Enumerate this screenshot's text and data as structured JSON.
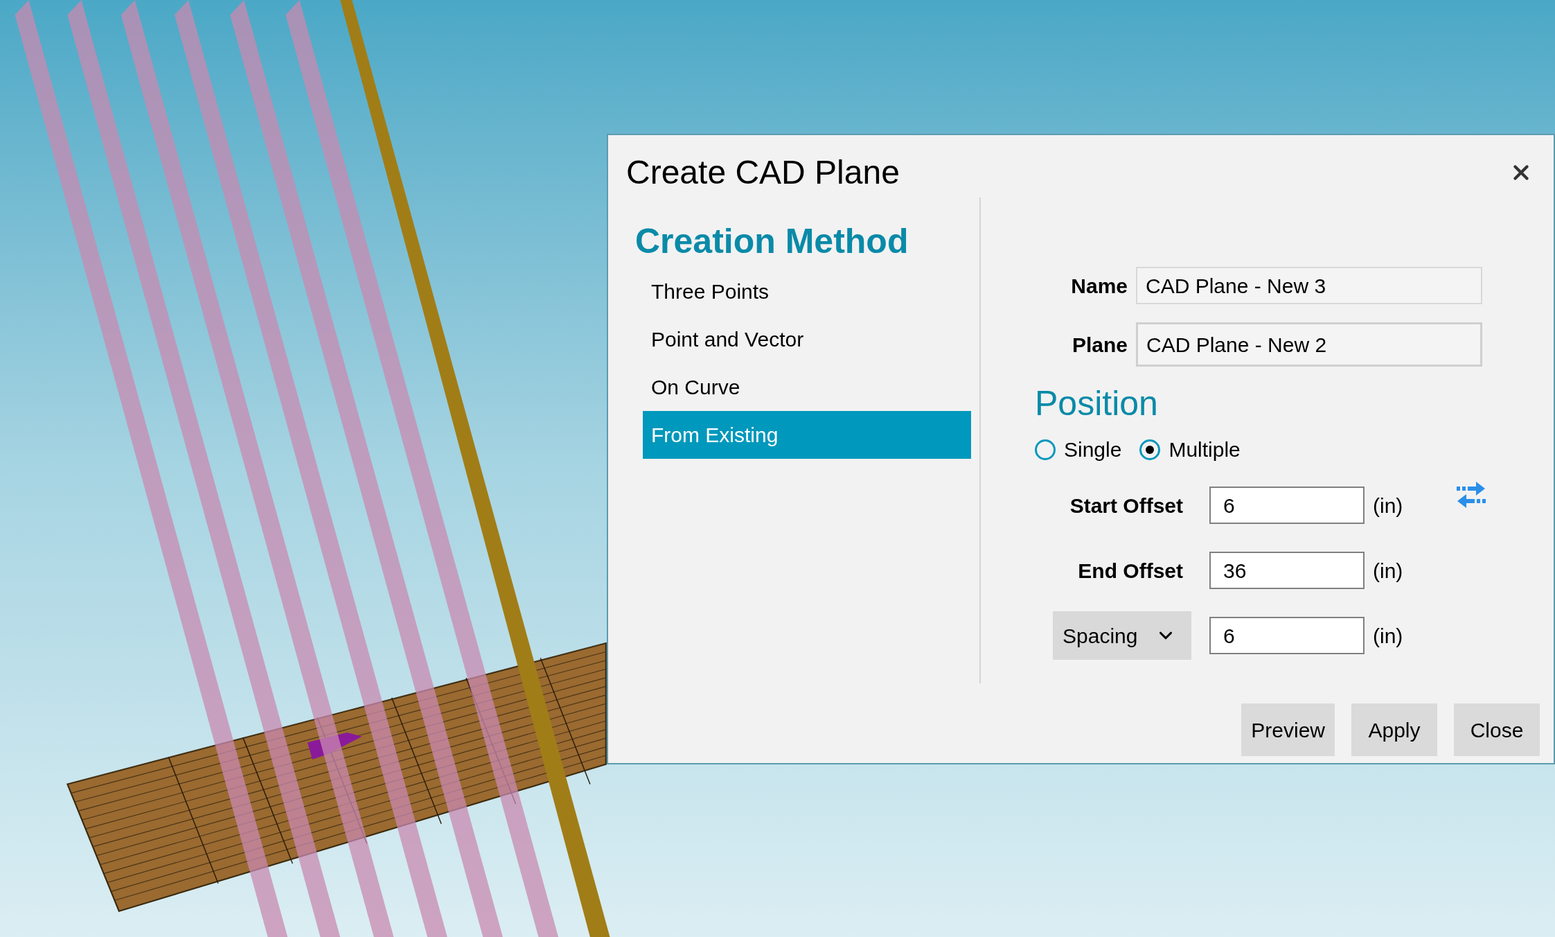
{
  "dialog": {
    "title": "Create CAD Plane",
    "creation_method": {
      "heading": "Creation Method",
      "items": [
        {
          "label": "Three Points",
          "selected": false
        },
        {
          "label": "Point and Vector",
          "selected": false
        },
        {
          "label": "On Curve",
          "selected": false
        },
        {
          "label": "From Existing",
          "selected": true
        }
      ]
    },
    "name": {
      "label": "Name",
      "value": "CAD Plane - New 3"
    },
    "plane": {
      "label": "Plane",
      "value": "CAD Plane - New 2"
    },
    "position": {
      "heading": "Position",
      "options": [
        {
          "label": "Single",
          "selected": false
        },
        {
          "label": "Multiple",
          "selected": true
        }
      ]
    },
    "offsets": [
      {
        "kind": "label",
        "label": "Start Offset",
        "value": "6",
        "unit": "(in)"
      },
      {
        "kind": "label",
        "label": "End Offset",
        "value": "36",
        "unit": "(in)"
      },
      {
        "kind": "dropdown",
        "label": "Spacing",
        "value": "6",
        "unit": "(in)"
      }
    ],
    "buttons": [
      "Preview",
      "Apply",
      "Close"
    ]
  }
}
